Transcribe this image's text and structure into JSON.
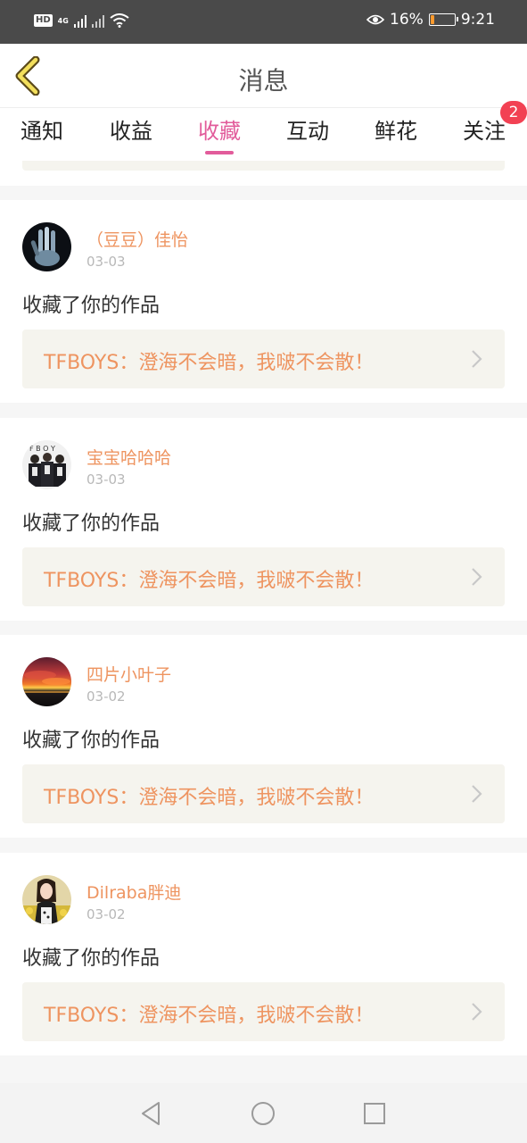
{
  "status_bar": {
    "left": {
      "hd": "HD",
      "network": "4G"
    },
    "battery_percent": "16%",
    "battery_level": 0.16,
    "time": "9:21"
  },
  "header": {
    "title": "消息"
  },
  "tabs": [
    "通知",
    "收益",
    "收藏",
    "互动",
    "鲜花",
    "关注"
  ],
  "active_tab_index": 2,
  "follow_badge": "2",
  "items": [
    {
      "username": "（豆豆）佳怡",
      "date": "03-03",
      "action": "收藏了你的作品",
      "work_title": "TFBOYS：澄海不会暗，我啵不会散！"
    },
    {
      "username": "宝宝哈哈哈",
      "date": "03-03",
      "action": "收藏了你的作品",
      "work_title": "TFBOYS：澄海不会暗，我啵不会散！"
    },
    {
      "username": "四片小叶子",
      "date": "03-02",
      "action": "收藏了你的作品",
      "work_title": "TFBOYS：澄海不会暗，我啵不会散！"
    },
    {
      "username": "Dilraba胖迪",
      "date": "03-02",
      "action": "收藏了你的作品",
      "work_title": "TFBOYS：澄海不会暗，我啵不会散！"
    }
  ],
  "colors": {
    "accent": "#e25c9b",
    "username": "#ee9460",
    "badge": "#f24153",
    "work_bg": "#f5f4ee"
  }
}
